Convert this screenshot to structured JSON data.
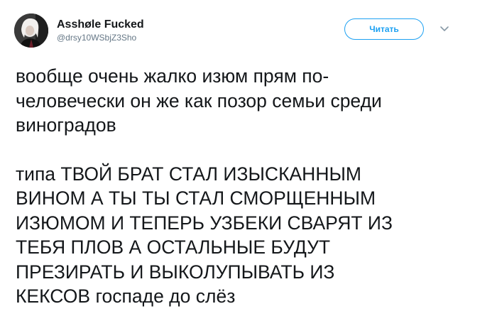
{
  "user": {
    "display_name": "Asshøle Fucked",
    "handle": "@drsy10WSbjZ3Sho"
  },
  "follow_button": {
    "label": "Читать"
  },
  "tweet": {
    "paragraph_1": "вообще очень жалко изюм прям по-\nчеловечески он же как позор семьи среди\nвиноградов",
    "paragraph_2": "типа ТВОЙ БРАТ СТАЛ ИЗЫСКАННЫМ\nВИНОМ А ТЫ ТЫ СТАЛ СМОРЩЕННЫМ\nИЗЮМОМ И ТЕПЕРЬ УЗБЕКИ СВАРЯТ ИЗ\nТЕБЯ ПЛОВ А ОСТАЛЬНЫЕ БУДУТ\nПРЕЗИРАТЬ И ВЫКОЛУПЫВАТЬ ИЗ\nКЕКСОВ госпаде до слёз"
  },
  "icons": {
    "avatar": "profile-photo",
    "more": "chevron-down-icon"
  },
  "colors": {
    "accent": "#1da1f2",
    "text": "#14171a",
    "secondary_text": "#657786",
    "caret": "#8899a6"
  }
}
